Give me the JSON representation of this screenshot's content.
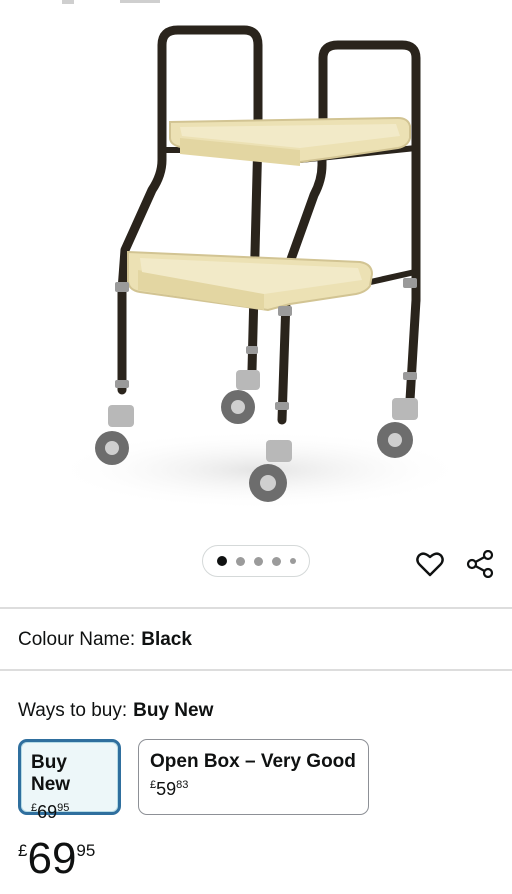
{
  "product": {
    "image_alt": "Black adjustable height trolley with two beige trays and four caster wheels",
    "image_count": 5,
    "current_image": 1
  },
  "actions": {
    "wishlist_icon": "heart-outline-icon",
    "share_icon": "share-icon"
  },
  "colour": {
    "label": "Colour Name:",
    "value": "Black"
  },
  "ways_to_buy": {
    "label": "Ways to buy:",
    "value": "Buy New",
    "options": [
      {
        "label": "Buy New",
        "currency": "£",
        "whole": "69",
        "fraction": "95",
        "selected": true
      },
      {
        "label": "Open Box – Very Good",
        "currency": "£",
        "whole": "59",
        "fraction": "83",
        "selected": false
      }
    ]
  },
  "price": {
    "currency": "£",
    "whole": "69",
    "fraction": "95"
  },
  "colors": {
    "selected_border": "#2f6f9e",
    "selected_bg": "#edf7f9",
    "frame": "#2a241c",
    "tray": "#ece1b4"
  }
}
